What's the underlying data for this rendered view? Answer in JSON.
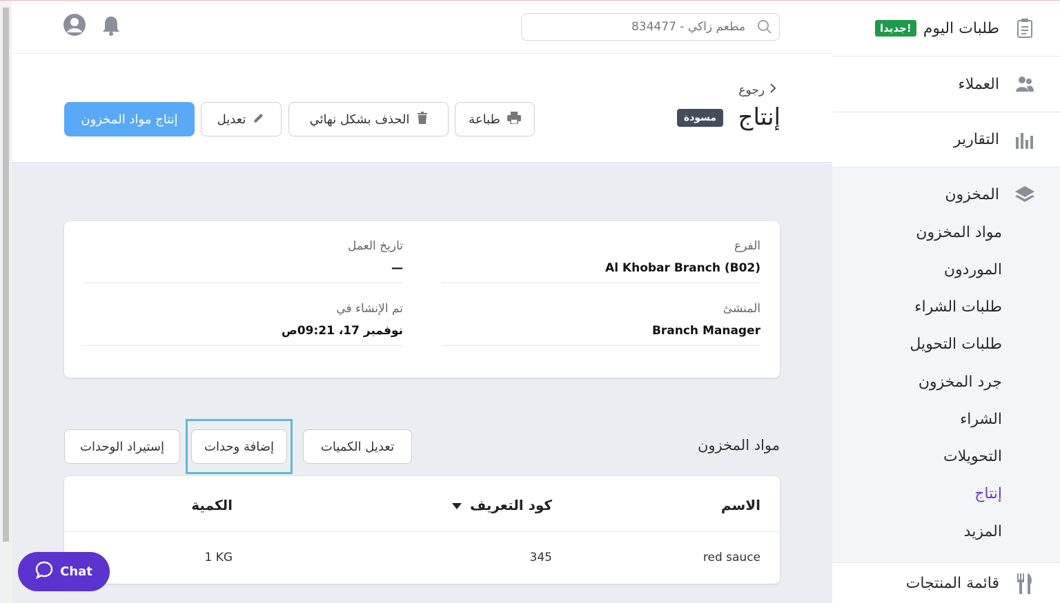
{
  "sidebar": {
    "today_orders": {
      "label": "طلبات اليوم",
      "badge": "جديدا!"
    },
    "customers": "العملاء",
    "reports": "التقارير",
    "inventory": {
      "label": "المخزون",
      "items": [
        {
          "label": "مواد المخزون",
          "active": false
        },
        {
          "label": "الموردون",
          "active": false
        },
        {
          "label": "طلبات الشراء",
          "active": false
        },
        {
          "label": "طلبات التحويل",
          "active": false
        },
        {
          "label": "جرد المخزون",
          "active": false
        },
        {
          "label": "الشراء",
          "active": false
        },
        {
          "label": "التحويلات",
          "active": false
        },
        {
          "label": "إنتاج",
          "active": true
        },
        {
          "label": "المزيد",
          "active": false
        }
      ]
    },
    "menu": "قائمة المنتجات"
  },
  "topbar": {
    "search_placeholder": "مطعم زاكي - 834477"
  },
  "header": {
    "back": "رجوع",
    "title": "إنتاج",
    "status": "مسودة",
    "buttons": {
      "print": "طباعة",
      "delete": "الحذف بشكل نهائي",
      "edit": "تعديل",
      "produce": "إنتاج مواد المخزون"
    }
  },
  "details": {
    "branch": {
      "label": "الفرع",
      "value": "Al Khobar Branch (B02)"
    },
    "business_date": {
      "label": "تاريخ العمل",
      "value": "—"
    },
    "creator": {
      "label": "المنشئ",
      "value": "Branch Manager"
    },
    "created_at": {
      "label": "تم الإنشاء في",
      "value": "نوفمبر 17، 09:21ص"
    }
  },
  "items_section": {
    "title": "مواد المخزون",
    "buttons": {
      "edit_quantities": "تعديل الكميات",
      "add_items": "إضافة وحدات",
      "import_items": "إستيراد الوحدات"
    },
    "columns": {
      "name": "الاسم",
      "sku": "كود التعريف",
      "quantity": "الكمية"
    },
    "rows": [
      {
        "name": "red sauce",
        "sku": "345",
        "quantity": "1 KG"
      }
    ]
  },
  "chat": {
    "label": "Chat"
  },
  "colors": {
    "primary": "#5aa9f6",
    "accent_purple": "#5b33cf",
    "active_link": "#6a3ad1",
    "badge_green": "#1e9a4a",
    "status_badge": "#454d5d"
  }
}
